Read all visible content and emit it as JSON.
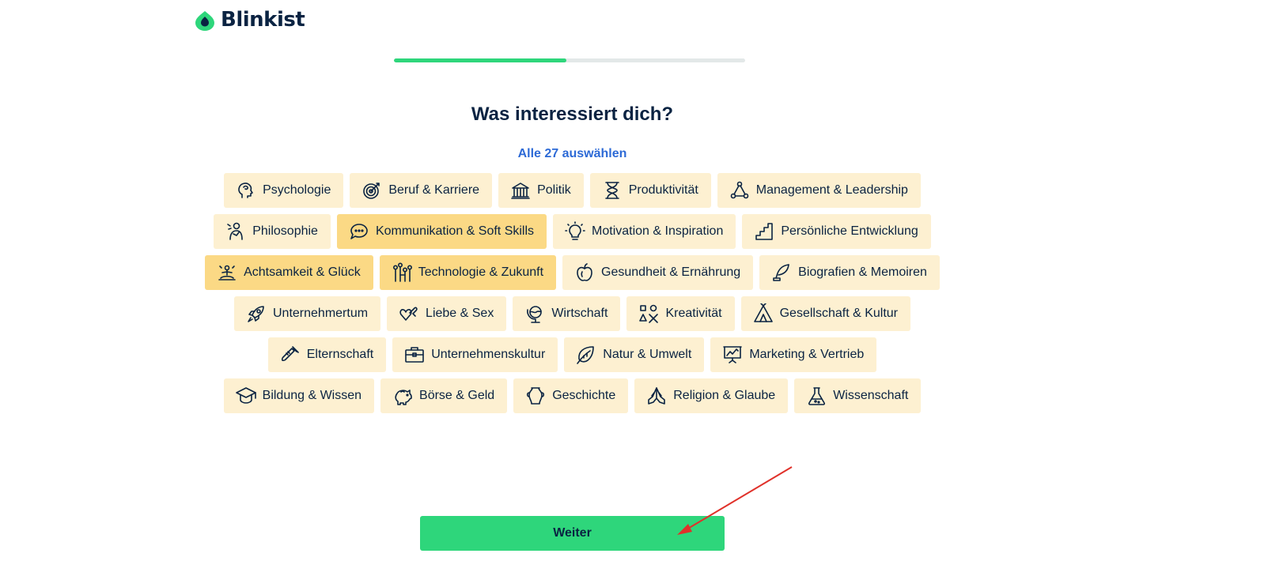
{
  "brand": {
    "name": "Blinkist",
    "color": "#2ed67b"
  },
  "progress": {
    "value_percent": 49
  },
  "heading": "Was interessiert dich?",
  "select_all": "Alle 27 auswählen",
  "chip_rows": [
    [
      {
        "label": "Psychologie",
        "icon": "head-icon",
        "selected": false
      },
      {
        "label": "Beruf & Karriere",
        "icon": "target-icon",
        "selected": false
      },
      {
        "label": "Politik",
        "icon": "building-columns-icon",
        "selected": false
      },
      {
        "label": "Produktivität",
        "icon": "hourglass-icon",
        "selected": false
      },
      {
        "label": "Management & Leadership",
        "icon": "network-icon",
        "selected": false
      }
    ],
    [
      {
        "label": "Philosophie",
        "icon": "thinker-icon",
        "selected": false
      },
      {
        "label": "Kommunikation & Soft Skills",
        "icon": "speech-bubble-icon",
        "selected": true
      },
      {
        "label": "Motivation & Inspiration",
        "icon": "lightbulb-icon",
        "selected": false
      },
      {
        "label": "Persönliche Entwicklung",
        "icon": "stairs-icon",
        "selected": false
      }
    ],
    [
      {
        "label": "Achtsamkeit & Glück",
        "icon": "meditation-icon",
        "selected": true
      },
      {
        "label": "Technologie & Zukunft",
        "icon": "circuit-icon",
        "selected": true
      },
      {
        "label": "Gesundheit & Ernährung",
        "icon": "apple-icon",
        "selected": false
      },
      {
        "label": "Biografien & Memoiren",
        "icon": "quill-icon",
        "selected": false
      }
    ],
    [
      {
        "label": "Unternehmertum",
        "icon": "rocket-icon",
        "selected": false
      },
      {
        "label": "Liebe & Sex",
        "icon": "hearts-icon",
        "selected": false
      },
      {
        "label": "Wirtschaft",
        "icon": "globe-icon",
        "selected": false
      },
      {
        "label": "Kreativität",
        "icon": "shapes-icon",
        "selected": false
      },
      {
        "label": "Gesellschaft & Kultur",
        "icon": "tent-icon",
        "selected": false
      }
    ],
    [
      {
        "label": "Elternschaft",
        "icon": "baby-bottle-icon",
        "selected": false
      },
      {
        "label": "Unternehmenskultur",
        "icon": "briefcase-icon",
        "selected": false
      },
      {
        "label": "Natur & Umwelt",
        "icon": "leaf-icon",
        "selected": false
      },
      {
        "label": "Marketing & Vertrieb",
        "icon": "presentation-icon",
        "selected": false
      }
    ],
    [
      {
        "label": "Bildung & Wissen",
        "icon": "graduation-cap-icon",
        "selected": false
      },
      {
        "label": "Börse & Geld",
        "icon": "piggy-bank-icon",
        "selected": false
      },
      {
        "label": "Geschichte",
        "icon": "vase-icon",
        "selected": false
      },
      {
        "label": "Religion & Glaube",
        "icon": "praying-hands-icon",
        "selected": false
      },
      {
        "label": "Wissenschaft",
        "icon": "flask-icon",
        "selected": false
      }
    ]
  ],
  "next_button": "Weiter",
  "colors": {
    "chip": "#fdf0d1",
    "chip_selected": "#fbd985",
    "text": "#0a2342",
    "link": "#2d6ad6",
    "button": "#2ed67b",
    "annotation_arrow": "#e0312a"
  }
}
